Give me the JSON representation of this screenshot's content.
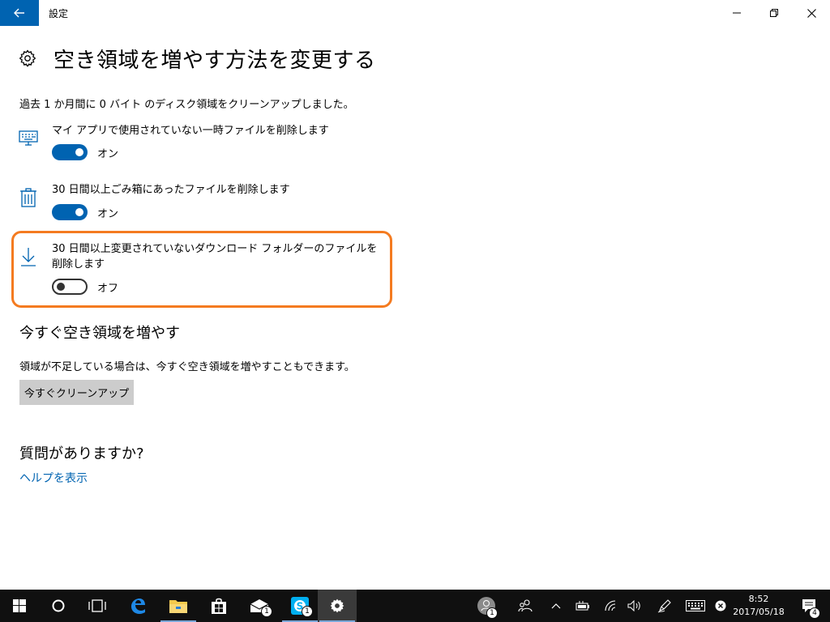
{
  "window": {
    "title": "設定"
  },
  "page": {
    "title": "空き領域を増やす方法を変更する",
    "summary": "過去 1 か月間に 0 バイト のディスク領域をクリーンアップしました。"
  },
  "options": [
    {
      "icon": "keyboard-monitor-icon",
      "label": "マイ アプリで使用されていない一時ファイルを削除します",
      "state": "オン",
      "on": true
    },
    {
      "icon": "trash-icon",
      "label": "30 日間以上ごみ箱にあったファイルを削除します",
      "state": "オン",
      "on": true
    },
    {
      "icon": "download-icon",
      "label": "30 日間以上変更されていないダウンロード フォルダーのファイルを削除します",
      "state": "オフ",
      "on": false
    }
  ],
  "free_now": {
    "heading": "今すぐ空き領域を増やす",
    "description": "領域が不足している場合は、今すぐ空き領域を増やすこともできます。",
    "button_label": "今すぐクリーンアップ"
  },
  "help": {
    "heading": "質問がありますか?",
    "link": "ヘルプを表示"
  },
  "taskbar": {
    "people_badge": "1",
    "mail_badge": "1",
    "skype_badge": "1",
    "notification_badge": "4",
    "time": "8:52",
    "date": "2017/05/18"
  },
  "colors": {
    "accent": "#0063b1",
    "highlight": "#f47b20",
    "taskbar": "#101010"
  }
}
